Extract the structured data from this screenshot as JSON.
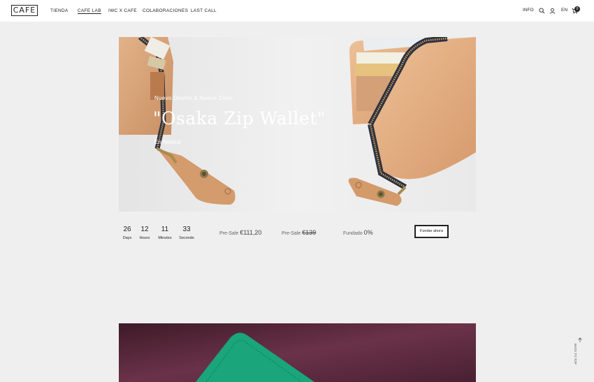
{
  "header": {
    "logo": "CAFE",
    "nav": [
      "TIENDA",
      "CAFE LAB",
      "IWC X CAFE",
      "COLABORACIONES",
      "LAST CALL"
    ],
    "info": "INFO",
    "language": "EN",
    "cart_count": "0"
  },
  "hero": {
    "kicker": "Nuevo Diseño & Nuevo Color",
    "title": "\"Osaka Zip Wallet\"",
    "subtitle": "En Natural"
  },
  "countdown": [
    {
      "value": "26",
      "label": "Days"
    },
    {
      "value": "12",
      "label": "Hours"
    },
    {
      "value": "11",
      "label": "Minutes"
    },
    {
      "value": "33",
      "label": "Seconds"
    }
  ],
  "pricing": {
    "presale_label": "Pre-Sale",
    "presale_price": "€111,20",
    "presale_label_2": "Pre-Sale",
    "original_price": "€139",
    "funded_label": "Fundado",
    "funded_value": "0%"
  },
  "cta_label": "Fundar ahora",
  "to_top": "BACK TO TOP",
  "colors": {
    "accent": "#222222",
    "leather": "#d9a67a",
    "banner": "#5a2a3c",
    "green": "#1aa57a"
  },
  "icons": [
    "search-icon",
    "user-icon",
    "cart-icon",
    "arrow-up-icon"
  ]
}
